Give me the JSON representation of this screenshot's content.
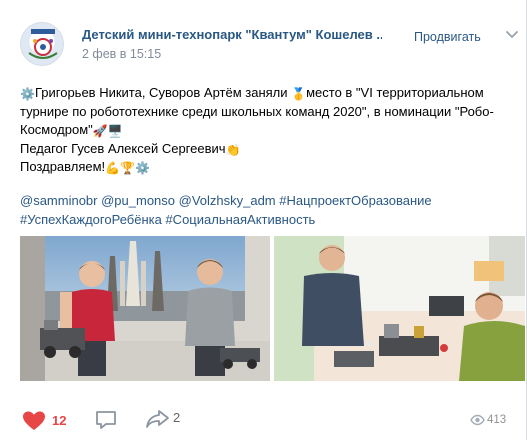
{
  "post": {
    "group_name": "Детский мини-технопарк \"Квантум\" Кошелев ...",
    "date": "2 фев в 15:15",
    "promote_label": "Продвигать",
    "text_lines": [
      {
        "emoji_before": "⚙️",
        "text": "Григорьев Никита, Суворов Артём заняли ",
        "emoji_mid": "🥇",
        "text_after": "место в \"VI территориальном"
      },
      {
        "text": "турнире по робототехнике среди школьных команд 2020\", в номинации \"Робо-"
      },
      {
        "text": "Космодром\"",
        "emoji_after": "🚀🖥️"
      },
      {
        "text": "Педагог Гусев Алексей Сергеевич",
        "emoji_after": "👏"
      },
      {
        "text": "Поздравляем!",
        "emoji_after": "💪🏆⚙️"
      }
    ],
    "tags_lines": [
      "@samminobr @pu_monso @Volzhsky_adm #НацпроектОбразование",
      "#УспехКаждогоРебёнка #СоциальнаяАктивность"
    ]
  },
  "footer": {
    "likes": "12",
    "shares": "2",
    "views": "413"
  },
  "icons": {
    "avatar": "kvantum-logo",
    "more": "chevron-down-icon",
    "like": "heart-icon",
    "comment": "comment-icon",
    "share": "share-arrow-icon",
    "views": "eye-icon"
  },
  "colors": {
    "link": "#2a5885",
    "like": "#e64646",
    "muted": "#818c99"
  }
}
